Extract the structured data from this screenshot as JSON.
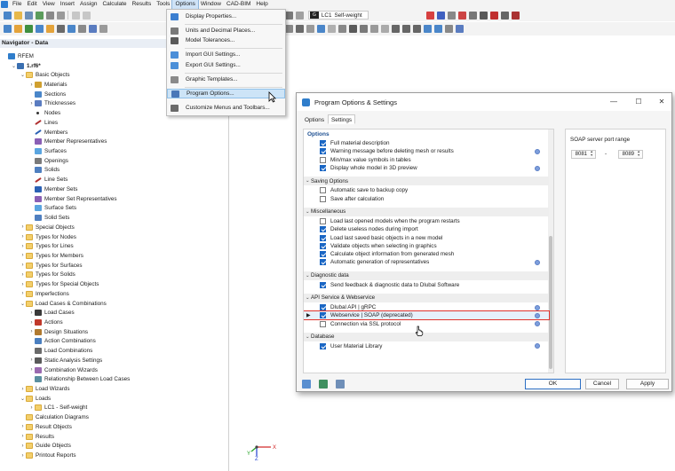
{
  "menu": {
    "items": [
      "File",
      "Edit",
      "View",
      "Insert",
      "Assign",
      "Calculate",
      "Results",
      "Tools",
      "Options",
      "Window",
      "CAD-BIM",
      "Help"
    ],
    "active": "Options"
  },
  "toolbar": {
    "combo_tag": "G",
    "combo_lc": "LC1",
    "combo_name": "Self-weight"
  },
  "navigator": {
    "title": "Navigator - Data",
    "items": [
      {
        "label": "RFEM",
        "indent": 0,
        "exp": "",
        "icon": "rfem-icon"
      },
      {
        "label": "1.rf6*",
        "indent": 1,
        "exp": "v",
        "icon": "model-icon",
        "bold": true
      },
      {
        "label": "Basic Objects",
        "indent": 2,
        "exp": "v",
        "icon": "folder-icon"
      },
      {
        "label": "Materials",
        "indent": 3,
        "exp": ">",
        "icon": "materials-icon"
      },
      {
        "label": "Sections",
        "indent": 3,
        "exp": "",
        "icon": "sections-icon"
      },
      {
        "label": "Thicknesses",
        "indent": 3,
        "exp": ">",
        "icon": "thickness-icon"
      },
      {
        "label": "Nodes",
        "indent": 3,
        "exp": "",
        "icon": "node-icon"
      },
      {
        "label": "Lines",
        "indent": 3,
        "exp": "",
        "icon": "line-icon"
      },
      {
        "label": "Members",
        "indent": 3,
        "exp": "",
        "icon": "member-icon"
      },
      {
        "label": "Member Representatives",
        "indent": 3,
        "exp": "",
        "icon": "member-rep-icon"
      },
      {
        "label": "Surfaces",
        "indent": 3,
        "exp": "",
        "icon": "surface-icon"
      },
      {
        "label": "Openings",
        "indent": 3,
        "exp": "",
        "icon": "opening-icon"
      },
      {
        "label": "Solids",
        "indent": 3,
        "exp": "",
        "icon": "solid-icon"
      },
      {
        "label": "Line Sets",
        "indent": 3,
        "exp": "",
        "icon": "line-set-icon"
      },
      {
        "label": "Member Sets",
        "indent": 3,
        "exp": "",
        "icon": "member-set-icon"
      },
      {
        "label": "Member Set Representatives",
        "indent": 3,
        "exp": "",
        "icon": "member-set-rep-icon"
      },
      {
        "label": "Surface Sets",
        "indent": 3,
        "exp": "",
        "icon": "surface-set-icon"
      },
      {
        "label": "Solid Sets",
        "indent": 3,
        "exp": "",
        "icon": "solid-set-icon"
      },
      {
        "label": "Special Objects",
        "indent": 2,
        "exp": ">",
        "icon": "folder-icon"
      },
      {
        "label": "Types for Nodes",
        "indent": 2,
        "exp": ">",
        "icon": "folder-icon"
      },
      {
        "label": "Types for Lines",
        "indent": 2,
        "exp": ">",
        "icon": "folder-icon"
      },
      {
        "label": "Types for Members",
        "indent": 2,
        "exp": ">",
        "icon": "folder-icon"
      },
      {
        "label": "Types for Surfaces",
        "indent": 2,
        "exp": ">",
        "icon": "folder-icon"
      },
      {
        "label": "Types for Solids",
        "indent": 2,
        "exp": ">",
        "icon": "folder-icon"
      },
      {
        "label": "Types for Special Objects",
        "indent": 2,
        "exp": ">",
        "icon": "folder-icon"
      },
      {
        "label": "Imperfections",
        "indent": 2,
        "exp": ">",
        "icon": "folder-icon"
      },
      {
        "label": "Load Cases & Combinations",
        "indent": 2,
        "exp": "v",
        "icon": "folder-icon"
      },
      {
        "label": "Load Cases",
        "indent": 3,
        "exp": ">",
        "icon": "load-case-icon"
      },
      {
        "label": "Actions",
        "indent": 3,
        "exp": ">",
        "icon": "actions-icon"
      },
      {
        "label": "Design Situations",
        "indent": 3,
        "exp": ">",
        "icon": "design-situation-icon"
      },
      {
        "label": "Action Combinations",
        "indent": 3,
        "exp": "",
        "icon": "action-combination-icon"
      },
      {
        "label": "Load Combinations",
        "indent": 3,
        "exp": "",
        "icon": "load-combination-icon"
      },
      {
        "label": "Static Analysis Settings",
        "indent": 3,
        "exp": ">",
        "icon": "analysis-settings-icon"
      },
      {
        "label": "Combination Wizards",
        "indent": 3,
        "exp": ">",
        "icon": "wizard-icon"
      },
      {
        "label": "Relationship Between Load Cases",
        "indent": 3,
        "exp": "",
        "icon": "relationship-icon"
      },
      {
        "label": "Load Wizards",
        "indent": 2,
        "exp": ">",
        "icon": "folder-icon"
      },
      {
        "label": "Loads",
        "indent": 2,
        "exp": "v",
        "icon": "folder-icon"
      },
      {
        "label": "LC1 - Self-weight",
        "indent": 3,
        "exp": ">",
        "icon": "folder-icon"
      },
      {
        "label": "Calculation Diagrams",
        "indent": 2,
        "exp": "",
        "icon": "folder-icon"
      },
      {
        "label": "Result Objects",
        "indent": 2,
        "exp": ">",
        "icon": "folder-icon"
      },
      {
        "label": "Results",
        "indent": 2,
        "exp": ">",
        "icon": "folder-icon"
      },
      {
        "label": "Guide Objects",
        "indent": 2,
        "exp": ">",
        "icon": "folder-icon"
      },
      {
        "label": "Printout Reports",
        "indent": 2,
        "exp": ">",
        "icon": "folder-icon"
      }
    ]
  },
  "options_menu": {
    "items": [
      {
        "label": "Display Properties...",
        "icon": "display-properties-icon",
        "color": "#3b7fd0"
      },
      {
        "label": "Units and Decimal Places...",
        "icon": "units-icon",
        "color": "#7a7a7a"
      },
      {
        "label": "Model Tolerances...",
        "icon": "tolerance-icon",
        "color": "#5a5a5a"
      },
      {
        "label": "Import GUI Settings...",
        "icon": "import-gui-icon",
        "color": "#4b8fd8"
      },
      {
        "label": "Export GUI Settings...",
        "icon": "export-gui-icon",
        "color": "#4b8fd8"
      },
      {
        "label": "Graphic Templates...",
        "icon": "graphic-templates-icon",
        "color": "#8a8a8a"
      },
      {
        "label": "Program Options...",
        "icon": "program-options-icon",
        "color": "#4a77b8",
        "hover": true
      },
      {
        "label": "Customize Menus and Toolbars...",
        "icon": "customize-icon",
        "color": "#6a6a6a"
      }
    ]
  },
  "dialog": {
    "title": "Program Options & Settings",
    "tabs": [
      "Options",
      "Settings"
    ],
    "active_tab": "Settings",
    "options_header": "Options",
    "sections": [
      {
        "title": "",
        "items": [
          {
            "label": "Full material description",
            "checked": true,
            "info": false
          },
          {
            "label": "Warning message before deleting mesh or results",
            "checked": true,
            "info": true
          },
          {
            "label": "Min/max value symbols in tables",
            "checked": false,
            "info": false
          },
          {
            "label": "Display whole model in 3D preview",
            "checked": true,
            "info": true
          }
        ]
      },
      {
        "title": "Saving Options",
        "items": [
          {
            "label": "Automatic save to backup copy",
            "checked": false,
            "info": false
          },
          {
            "label": "Save after calculation",
            "checked": false,
            "info": false
          }
        ]
      },
      {
        "title": "Miscellaneous",
        "items": [
          {
            "label": "Load last opened models when the program restarts",
            "checked": false,
            "info": false
          },
          {
            "label": "Delete useless nodes during import",
            "checked": true,
            "info": false
          },
          {
            "label": "Load last saved basic objects in a new model",
            "checked": true,
            "info": false
          },
          {
            "label": "Validate objects when selecting in graphics",
            "checked": true,
            "info": false
          },
          {
            "label": "Calculate object information from generated mesh",
            "checked": true,
            "info": false
          },
          {
            "label": "Automatic generation of representatives",
            "checked": true,
            "info": true
          }
        ]
      },
      {
        "title": "Diagnostic data",
        "items": [
          {
            "label": "Send feedback & diagnostic data to Dlubal Software",
            "checked": true,
            "info": false
          }
        ]
      },
      {
        "title": "API Service & Webservice",
        "items": [
          {
            "label": "Dlubal API | gRPC",
            "checked": true,
            "info": true
          },
          {
            "label": "Webservice | SOAP (deprecated)",
            "checked": true,
            "info": true,
            "highlight": true
          },
          {
            "label": "Connection via SSL protocol",
            "checked": false,
            "info": true
          }
        ]
      },
      {
        "title": "Database",
        "items": [
          {
            "label": "User Material Library",
            "checked": true,
            "info": true
          }
        ]
      }
    ],
    "soap": {
      "label": "SOAP server port range",
      "from": "8081",
      "separator": "-",
      "to": "8089"
    },
    "buttons": {
      "ok": "OK",
      "cancel": "Cancel",
      "apply": "Apply"
    }
  },
  "axes": {
    "x": "X",
    "y": "Y",
    "z": "Z"
  }
}
